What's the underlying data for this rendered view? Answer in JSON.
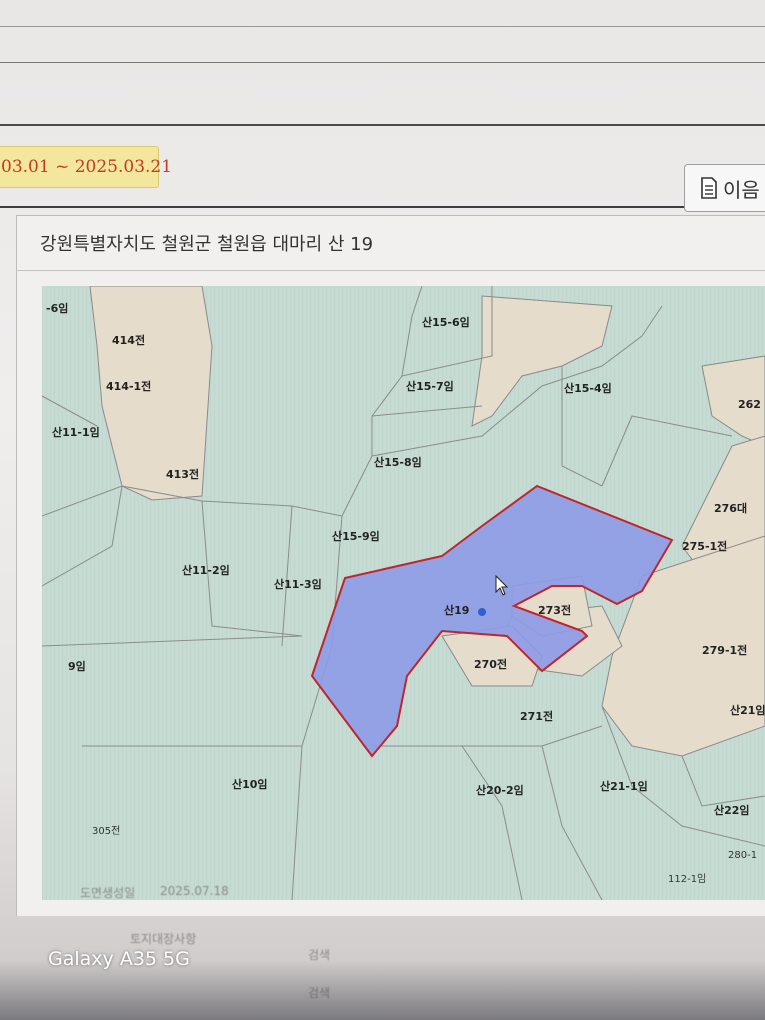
{
  "header": {
    "date_range": "03.01 ~ 2025.03.21",
    "next_button_label": "이음"
  },
  "parcel": {
    "address": "강원특별자치도 철원군 철원읍 대마리 산 19"
  },
  "map": {
    "selected_parcel": "산19",
    "highlight_color": "#8e9be6",
    "highlight_border": "#c0252b",
    "forest_color": "#c8dcd4",
    "field_color": "#e6ddcc",
    "labels": [
      "-6임",
      "414전",
      "414-1전",
      "산11-1임",
      "413전",
      "산15-6임",
      "산15-7임",
      "산15-8임",
      "산15-4임",
      "262",
      "산15-9임",
      "276대",
      "275-1전",
      "산11-2임",
      "산11-3임",
      "273전",
      "270전",
      "279-1전",
      "9임",
      "271전",
      "산21임",
      "산10임",
      "산20-2임",
      "산21-1임",
      "산22임",
      "280-1",
      "112-1임",
      "305전"
    ]
  },
  "footer": {
    "base_date_label": "도면생성일",
    "base_date_value": "2025.07.18",
    "row_label": "토지대장사항",
    "cell1": "검색",
    "cell2": "검색"
  },
  "device_watermark": "Galaxy A35 5G"
}
